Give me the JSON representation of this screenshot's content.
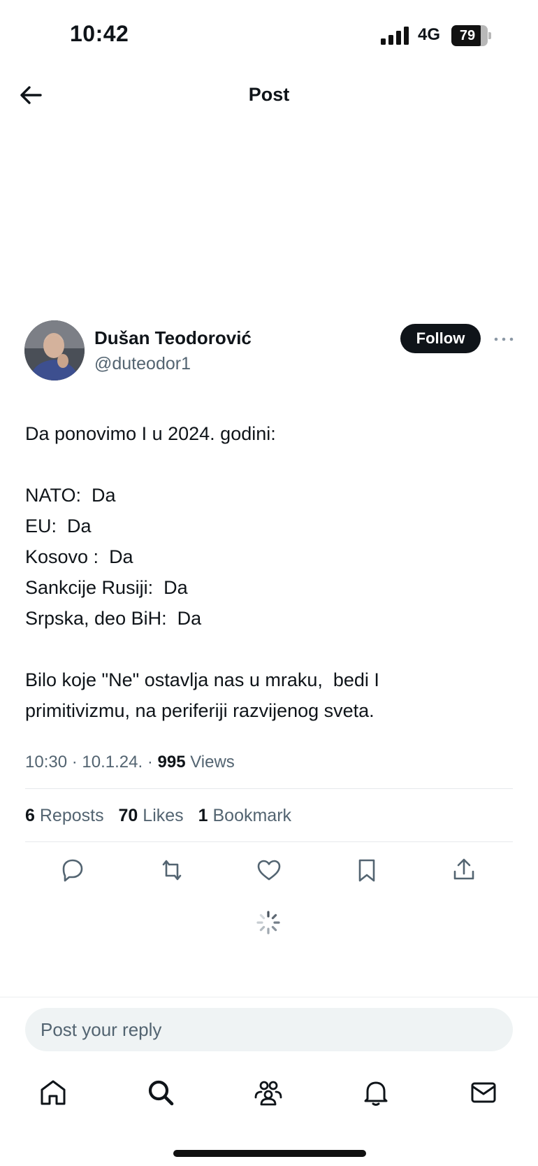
{
  "status_bar": {
    "time": "10:42",
    "network": "4G",
    "battery": "79"
  },
  "header": {
    "title": "Post",
    "back_icon": "arrow-left-icon"
  },
  "author": {
    "name": "Dušan Teodorović",
    "handle": "@duteodor1",
    "follow_label": "Follow",
    "more_icon": "more-horizontal-icon"
  },
  "post": {
    "lines": [
      "Da ponovimo I u 2024. godini:",
      "",
      "NATO:  Da",
      "EU:  Da",
      "Kosovo :  Da",
      "Sankcije Rusiji:  Da",
      "Srpska, deo BiH:  Da",
      "",
      "Bilo koje \"Ne\" ostavlja nas u mraku,  bedi I",
      "primitivizmu, na periferiji razvijenog sveta."
    ],
    "time": "10:30",
    "date": "10.1.24.",
    "views_count": "995",
    "views_label": "Views"
  },
  "stats": {
    "reposts_count": "6",
    "reposts_label": "Reposts",
    "likes_count": "70",
    "likes_label": "Likes",
    "bookmarks_count": "1",
    "bookmarks_label": "Bookmark"
  },
  "actions": [
    "reply-icon",
    "repost-icon",
    "like-icon",
    "bookmark-icon",
    "share-icon"
  ],
  "reply": {
    "placeholder": "Post your reply"
  },
  "bottom_nav": [
    "home-icon",
    "search-icon",
    "communities-icon",
    "notifications-icon",
    "messages-icon"
  ]
}
